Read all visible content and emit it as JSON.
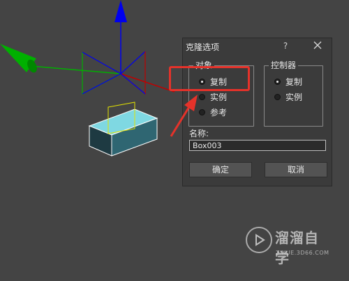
{
  "dialog": {
    "title": "克隆选项",
    "help_label": "?",
    "object_group": {
      "legend": "对象",
      "options": [
        {
          "label": "复制",
          "checked": true
        },
        {
          "label": "实例",
          "checked": false
        },
        {
          "label": "参考",
          "checked": false
        }
      ]
    },
    "controller_group": {
      "legend": "控制器",
      "options": [
        {
          "label": "复制",
          "checked": true
        },
        {
          "label": "实例",
          "checked": false
        }
      ]
    },
    "name_label": "名称:",
    "name_value": "Box003",
    "ok_label": "确定",
    "cancel_label": "取消"
  },
  "viewport": {
    "background": "#444444",
    "gizmo_colors": {
      "z": "#0000ee",
      "y": "#00c000",
      "x": "#c00000"
    },
    "box_color": "#5fc6d2"
  },
  "annotation": {
    "color": "#e5322a"
  },
  "watermark": {
    "name": "溜溜自学",
    "url": "ZIXUE.3D66.COM"
  }
}
